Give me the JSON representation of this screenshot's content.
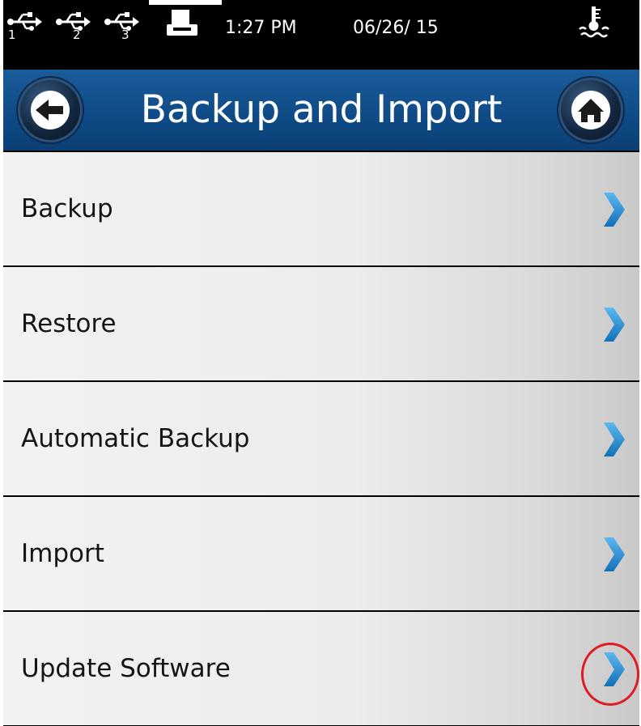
{
  "status_bar": {
    "usb_ports": [
      {
        "number": "1",
        "icon": "usb-icon"
      },
      {
        "number": "2",
        "icon": "usb-icon"
      },
      {
        "number": "3",
        "icon": "usb-icon"
      }
    ],
    "printer_icon": "printer-icon",
    "time": "1:27 PM",
    "date": "06/26/ 15",
    "temperature_icon": "water-temperature-icon"
  },
  "header": {
    "title": "Backup and Import",
    "back_icon": "back-arrow-icon",
    "home_icon": "home-icon",
    "color": "#0f4a86"
  },
  "menu": {
    "items": [
      {
        "label": "Backup",
        "icon": "chevron-right-icon"
      },
      {
        "label": "Restore",
        "icon": "chevron-right-icon"
      },
      {
        "label": "Automatic Backup",
        "icon": "chevron-right-icon"
      },
      {
        "label": "Import",
        "icon": "chevron-right-icon"
      },
      {
        "label": "Update Software",
        "icon": "chevron-right-icon",
        "highlighted": true
      }
    ],
    "chevron_color": "#2a8fd8",
    "highlight_color": "#e01b24"
  }
}
